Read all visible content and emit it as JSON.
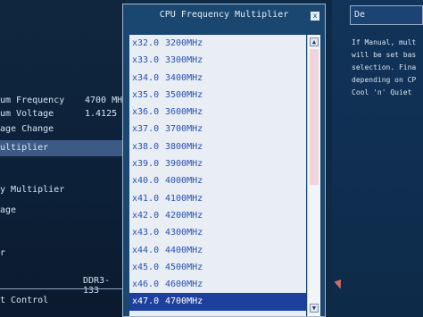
{
  "left": {
    "rows": [
      {
        "label": "um Frequency",
        "value": "4700 MHz"
      },
      {
        "label": "um Voltage",
        "value": "1.4125 V"
      },
      {
        "label": "age Change"
      },
      {
        "label": "ultiplier",
        "selected": true
      },
      {
        "label": "y Multiplier"
      },
      {
        "label": "age"
      },
      {
        "label": "r"
      }
    ],
    "ddr_label": "DDR3-133",
    "footer": "t Control"
  },
  "popup": {
    "title": "CPU Frequency Multiplier",
    "close_glyph": "x",
    "items": [
      {
        "multiplier": "x32.0",
        "freq": "3200MHz"
      },
      {
        "multiplier": "x33.0",
        "freq": "3300MHz"
      },
      {
        "multiplier": "x34.0",
        "freq": "3400MHz"
      },
      {
        "multiplier": "x35.0",
        "freq": "3500MHz"
      },
      {
        "multiplier": "x36.0",
        "freq": "3600MHz"
      },
      {
        "multiplier": "x37.0",
        "freq": "3700MHz"
      },
      {
        "multiplier": "x38.0",
        "freq": "3800MHz"
      },
      {
        "multiplier": "x39.0",
        "freq": "3900MHz"
      },
      {
        "multiplier": "x40.0",
        "freq": "4000MHz"
      },
      {
        "multiplier": "x41.0",
        "freq": "4100MHz"
      },
      {
        "multiplier": "x42.0",
        "freq": "4200MHz"
      },
      {
        "multiplier": "x43.0",
        "freq": "4300MHz"
      },
      {
        "multiplier": "x44.0",
        "freq": "4400MHz"
      },
      {
        "multiplier": "x45.0",
        "freq": "4500MHz"
      },
      {
        "multiplier": "x46.0",
        "freq": "4600MHz"
      },
      {
        "multiplier": "x47.0",
        "freq": "4700MHz",
        "selected": true
      }
    ],
    "scroll_up": "▲",
    "scroll_down": "▼"
  },
  "help": {
    "title": "De",
    "lines": [
      "If Manual, mult",
      "will be set bas",
      "selection. Fina",
      "depending on CP",
      "Cool 'n' Quiet"
    ]
  },
  "colors": {
    "accent": "#1d3f9e",
    "panel": "#1a4770"
  }
}
